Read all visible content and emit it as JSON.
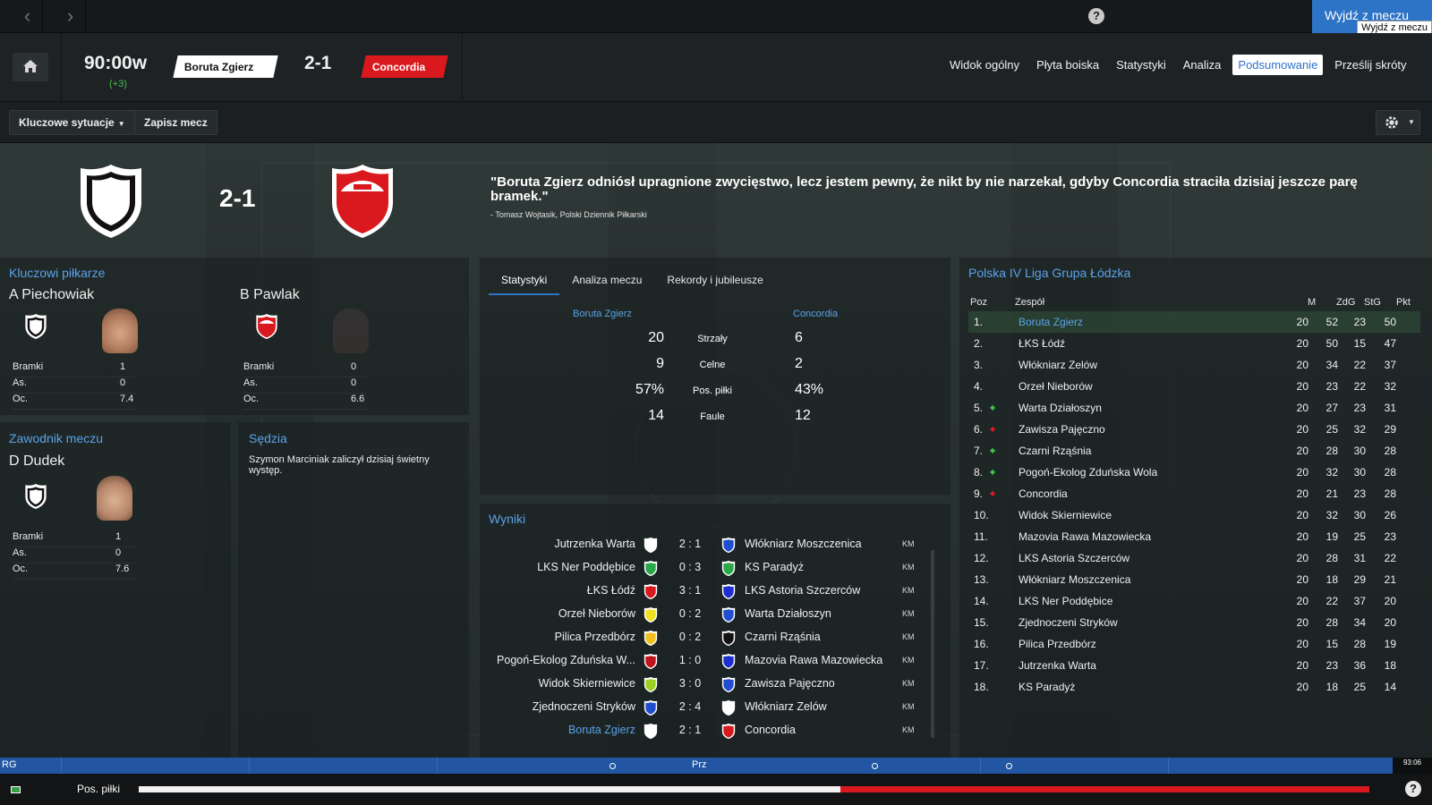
{
  "topbar": {
    "exit_label": "Wyjdź z meczu",
    "exit_tooltip": "Wyjdź z meczu",
    "help": "?"
  },
  "header": {
    "clock": "90:00w",
    "added_time": "(+3)",
    "home_team": "Boruta Zgierz",
    "away_team": "Concordia",
    "score": "2-1",
    "tabs": [
      {
        "label": "Widok ogólny",
        "active": false
      },
      {
        "label": "Płyta boiska",
        "active": false
      },
      {
        "label": "Statystyki",
        "active": false
      },
      {
        "label": "Analiza",
        "active": false
      },
      {
        "label": "Podsumowanie",
        "active": true
      },
      {
        "label": "Prześlij skróty",
        "active": false
      }
    ]
  },
  "toolbar": {
    "key_moments": "Kluczowe sytuacje",
    "save_match": "Zapisz mecz"
  },
  "summary": {
    "score": "2-1",
    "quote": "\"Boruta Zgierz odniósł upragnione zwycięstwo, lecz jestem pewny, że nikt by nie narzekał, gdyby Concordia straciła dzisiaj jeszcze parę bramek.\"",
    "quote_source": "- Tomasz Wojtasik, Polski Dziennik Piłkarski"
  },
  "key_players": {
    "title": "Kluczowi piłkarze",
    "home": {
      "name": "A Piechowiak",
      "goals": "1",
      "assists": "0",
      "rating": "7.4"
    },
    "away": {
      "name": "B Pawlak",
      "goals": "0",
      "assists": "0",
      "rating": "6.6"
    },
    "labels": {
      "goals": "Bramki",
      "assists": "As.",
      "rating": "Oc."
    }
  },
  "man_of_match": {
    "title": "Zawodnik meczu",
    "name": "D Dudek",
    "goals": "1",
    "assists": "0",
    "rating": "7.6"
  },
  "referee": {
    "title": "Sędzia",
    "text": "Szymon Marciniak zaliczył dzisiaj świetny występ."
  },
  "stats_panel": {
    "tabs": [
      {
        "label": "Statystyki",
        "active": true
      },
      {
        "label": "Analiza meczu",
        "active": false
      },
      {
        "label": "Rekordy i jubileusze",
        "active": false
      }
    ],
    "home_team": "Boruta Zgierz",
    "away_team": "Concordia",
    "rows": [
      {
        "name": "Strzały",
        "home": "20",
        "away": "6"
      },
      {
        "name": "Celne",
        "home": "9",
        "away": "2"
      },
      {
        "name": "Pos. piłki",
        "home": "57%",
        "away": "43%"
      },
      {
        "name": "Faule",
        "home": "14",
        "away": "12"
      }
    ]
  },
  "results": {
    "title": "Wyniki",
    "rows": [
      {
        "home": "Jutrzenka Warta",
        "home_color": "#ffffff",
        "score": "2 : 1",
        "away": "Włókniarz Moszczenica",
        "away_color": "#1f4fd0",
        "tag": "KM",
        "highlight": false
      },
      {
        "home": "LKS Ner Poddębice",
        "home_color": "#2aa84a",
        "score": "0 : 3",
        "away": "KS Paradyż",
        "away_color": "#2aa84a",
        "tag": "KM",
        "highlight": false
      },
      {
        "home": "ŁKS Łódź",
        "home_color": "#d9191d",
        "score": "3 : 1",
        "away": "LKS Astoria Szczerców",
        "away_color": "#1f2fd0",
        "tag": "KM",
        "highlight": false
      },
      {
        "home": "Orzeł Nieborów",
        "home_color": "#f0e020",
        "score": "0 : 2",
        "away": "Warta Działoszyn",
        "away_color": "#1f4fd0",
        "tag": "KM",
        "highlight": false
      },
      {
        "home": "Pilica Przedbórz",
        "home_color": "#f0c020",
        "score": "0 : 2",
        "away": "Czarni Rząśnia",
        "away_color": "#111111",
        "tag": "KM",
        "highlight": false
      },
      {
        "home": "Pogoń-Ekolog Zduńska W...",
        "home_color": "#c0141c",
        "score": "1 : 0",
        "away": "Mazovia Rawa Mazowiecka",
        "away_color": "#1f2fd0",
        "tag": "KM",
        "highlight": false
      },
      {
        "home": "Widok Skierniewice",
        "home_color": "#9cd020",
        "score": "3 : 0",
        "away": "Zawisza Pajęczno",
        "away_color": "#1f4fd0",
        "tag": "KM",
        "highlight": false
      },
      {
        "home": "Zjednoczeni Stryków",
        "home_color": "#1f4fd0",
        "score": "2 : 4",
        "away": "Włókniarz Zelów",
        "away_color": "#ffffff",
        "tag": "KM",
        "highlight": false
      },
      {
        "home": "Boruta Zgierz",
        "home_color": "#ffffff",
        "score": "2 : 1",
        "away": "Concordia",
        "away_color": "#d9191d",
        "tag": "KM",
        "highlight": true
      }
    ]
  },
  "league": {
    "title": "Polska IV Liga Grupa Łódzka",
    "headers": {
      "pos": "Poz",
      "team": "Zespół",
      "m": "M",
      "gf": "ZdG",
      "ga": "StG",
      "pts": "Pkt"
    },
    "rows": [
      {
        "pos": "1.",
        "move": "",
        "team": "Boruta Zgierz",
        "m": "20",
        "gf": "52",
        "ga": "23",
        "pts": "50",
        "highlight": true
      },
      {
        "pos": "2.",
        "move": "",
        "team": "ŁKS Łódź",
        "m": "20",
        "gf": "50",
        "ga": "15",
        "pts": "47",
        "highlight": false
      },
      {
        "pos": "3.",
        "move": "",
        "team": "Włókniarz Zelów",
        "m": "20",
        "gf": "34",
        "ga": "22",
        "pts": "37",
        "highlight": false
      },
      {
        "pos": "4.",
        "move": "",
        "team": "Orzeł Nieborów",
        "m": "20",
        "gf": "23",
        "ga": "22",
        "pts": "32",
        "highlight": false
      },
      {
        "pos": "5.",
        "move": "up",
        "team": "Warta Działoszyn",
        "m": "20",
        "gf": "27",
        "ga": "23",
        "pts": "31",
        "highlight": false
      },
      {
        "pos": "6.",
        "move": "down",
        "team": "Zawisza Pajęczno",
        "m": "20",
        "gf": "25",
        "ga": "32",
        "pts": "29",
        "highlight": false
      },
      {
        "pos": "7.",
        "move": "up",
        "team": "Czarni Rząśnia",
        "m": "20",
        "gf": "28",
        "ga": "30",
        "pts": "28",
        "highlight": false
      },
      {
        "pos": "8.",
        "move": "up",
        "team": "Pogoń-Ekolog Zduńska Wola",
        "m": "20",
        "gf": "32",
        "ga": "30",
        "pts": "28",
        "highlight": false
      },
      {
        "pos": "9.",
        "move": "down",
        "team": "Concordia",
        "m": "20",
        "gf": "21",
        "ga": "23",
        "pts": "28",
        "highlight": false
      },
      {
        "pos": "10.",
        "move": "",
        "team": "Widok Skierniewice",
        "m": "20",
        "gf": "32",
        "ga": "30",
        "pts": "26",
        "highlight": false
      },
      {
        "pos": "11.",
        "move": "",
        "team": "Mazovia Rawa Mazowiecka",
        "m": "20",
        "gf": "19",
        "ga": "25",
        "pts": "23",
        "highlight": false
      },
      {
        "pos": "12.",
        "move": "",
        "team": "LKS Astoria Szczerców",
        "m": "20",
        "gf": "28",
        "ga": "31",
        "pts": "22",
        "highlight": false
      },
      {
        "pos": "13.",
        "move": "",
        "team": "Włókniarz Moszczenica",
        "m": "20",
        "gf": "18",
        "ga": "29",
        "pts": "21",
        "highlight": false
      },
      {
        "pos": "14.",
        "move": "",
        "team": "LKS Ner Poddębice",
        "m": "20",
        "gf": "22",
        "ga": "37",
        "pts": "20",
        "highlight": false
      },
      {
        "pos": "15.",
        "move": "",
        "team": "Zjednoczeni Stryków",
        "m": "20",
        "gf": "28",
        "ga": "34",
        "pts": "20",
        "highlight": false
      },
      {
        "pos": "16.",
        "move": "",
        "team": "Pilica Przedbórz",
        "m": "20",
        "gf": "15",
        "ga": "28",
        "pts": "19",
        "highlight": false
      },
      {
        "pos": "17.",
        "move": "",
        "team": "Jutrzenka Warta",
        "m": "20",
        "gf": "23",
        "ga": "36",
        "pts": "18",
        "highlight": false
      },
      {
        "pos": "18.",
        "move": "",
        "team": "KS Paradyż",
        "m": "20",
        "gf": "18",
        "ga": "25",
        "pts": "14",
        "highlight": false
      }
    ]
  },
  "bottom": {
    "left_label": "RG",
    "mid_label": "Prz",
    "time": "93:06",
    "possession_label": "Pos. piłki",
    "home_possession": 0.57
  },
  "colors": {
    "accent": "#2d73c6",
    "link": "#5aa3e8",
    "home": "#ffffff",
    "away": "#d9191d",
    "up": "#3cc04a",
    "down": "#d9191d"
  }
}
